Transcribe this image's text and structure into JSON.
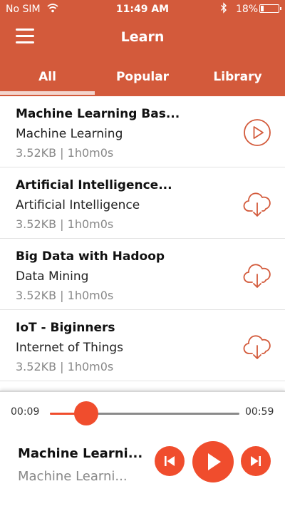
{
  "status_bar": {
    "carrier": "No SIM",
    "time": "11:49 AM",
    "battery_text": "18%",
    "battery_level": 0.18
  },
  "nav": {
    "title": "Learn"
  },
  "tabs": [
    {
      "label": "All",
      "selected": true
    },
    {
      "label": "Popular",
      "selected": false
    },
    {
      "label": "Library",
      "selected": false
    }
  ],
  "items": [
    {
      "title": "Machine Learning Bas...",
      "category": "Machine Learning",
      "meta": "3.52KB | 1h0m0s",
      "action_icon": "play-circle-icon"
    },
    {
      "title": "Artificial Intelligence...",
      "category": "Artificial Intelligence",
      "meta": "3.52KB | 1h0m0s",
      "action_icon": "cloud-download-icon"
    },
    {
      "title": "Big Data with Hadoop",
      "category": "Data Mining",
      "meta": "3.52KB | 1h0m0s",
      "action_icon": "cloud-download-icon"
    },
    {
      "title": "IoT - Biginners",
      "category": "Internet of Things",
      "meta": "3.52KB | 1h0m0s",
      "action_icon": "cloud-download-icon"
    }
  ],
  "player": {
    "current_time": "00:09",
    "total_time": "00:59",
    "progress": 0.19,
    "now_playing_title": "Machine Learni...",
    "now_playing_subtitle": "Machine Learni..."
  },
  "colors": {
    "brand": "#d35a3b",
    "accent": "#f04d2d"
  }
}
